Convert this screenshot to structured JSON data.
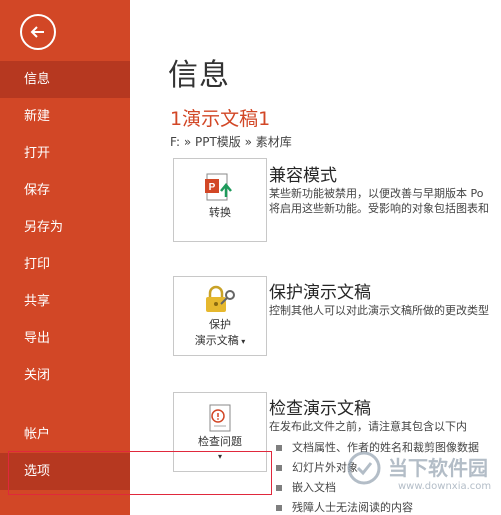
{
  "sidebar": {
    "back_label": "",
    "items": [
      {
        "label": "信息"
      },
      {
        "label": "新建"
      },
      {
        "label": "打开"
      },
      {
        "label": "保存"
      },
      {
        "label": "另存为"
      },
      {
        "label": "打印"
      },
      {
        "label": "共享"
      },
      {
        "label": "导出"
      },
      {
        "label": "关闭"
      },
      {
        "label": "帐户"
      },
      {
        "label": "选项"
      }
    ]
  },
  "main": {
    "title": "信息",
    "doc_title": "1演示文稿1",
    "breadcrumb": "F: » PPT模版 » 素材库",
    "compat": {
      "button_label": "转换",
      "title": "兼容模式",
      "desc_line1": "某些新功能被禁用，以便改善与早期版本 Po",
      "desc_line2": "将启用这些新功能。受影响的对象包括图表和"
    },
    "protect": {
      "button_label_line1": "保护",
      "button_label_line2": "演示文稿",
      "title": "保护演示文稿",
      "desc": "控制其他人可以对此演示文稿所做的更改类型"
    },
    "inspect": {
      "button_label": "检查问题",
      "title": "检查演示文稿",
      "desc": "在发布此文件之前，请注意其包含以下内",
      "bullets": [
        "文档属性、作者的姓名和裁剪图像数据",
        "幻灯片外对象",
        "嵌入文档",
        "残障人士无法阅读的内容"
      ]
    }
  },
  "watermark": {
    "text": "当下软件园",
    "url": "www.downxia.com"
  },
  "colors": {
    "sidebar": "#d24726",
    "sidebar_active": "#b63820",
    "accent": "#d24726",
    "highlight": "#e0283c"
  }
}
